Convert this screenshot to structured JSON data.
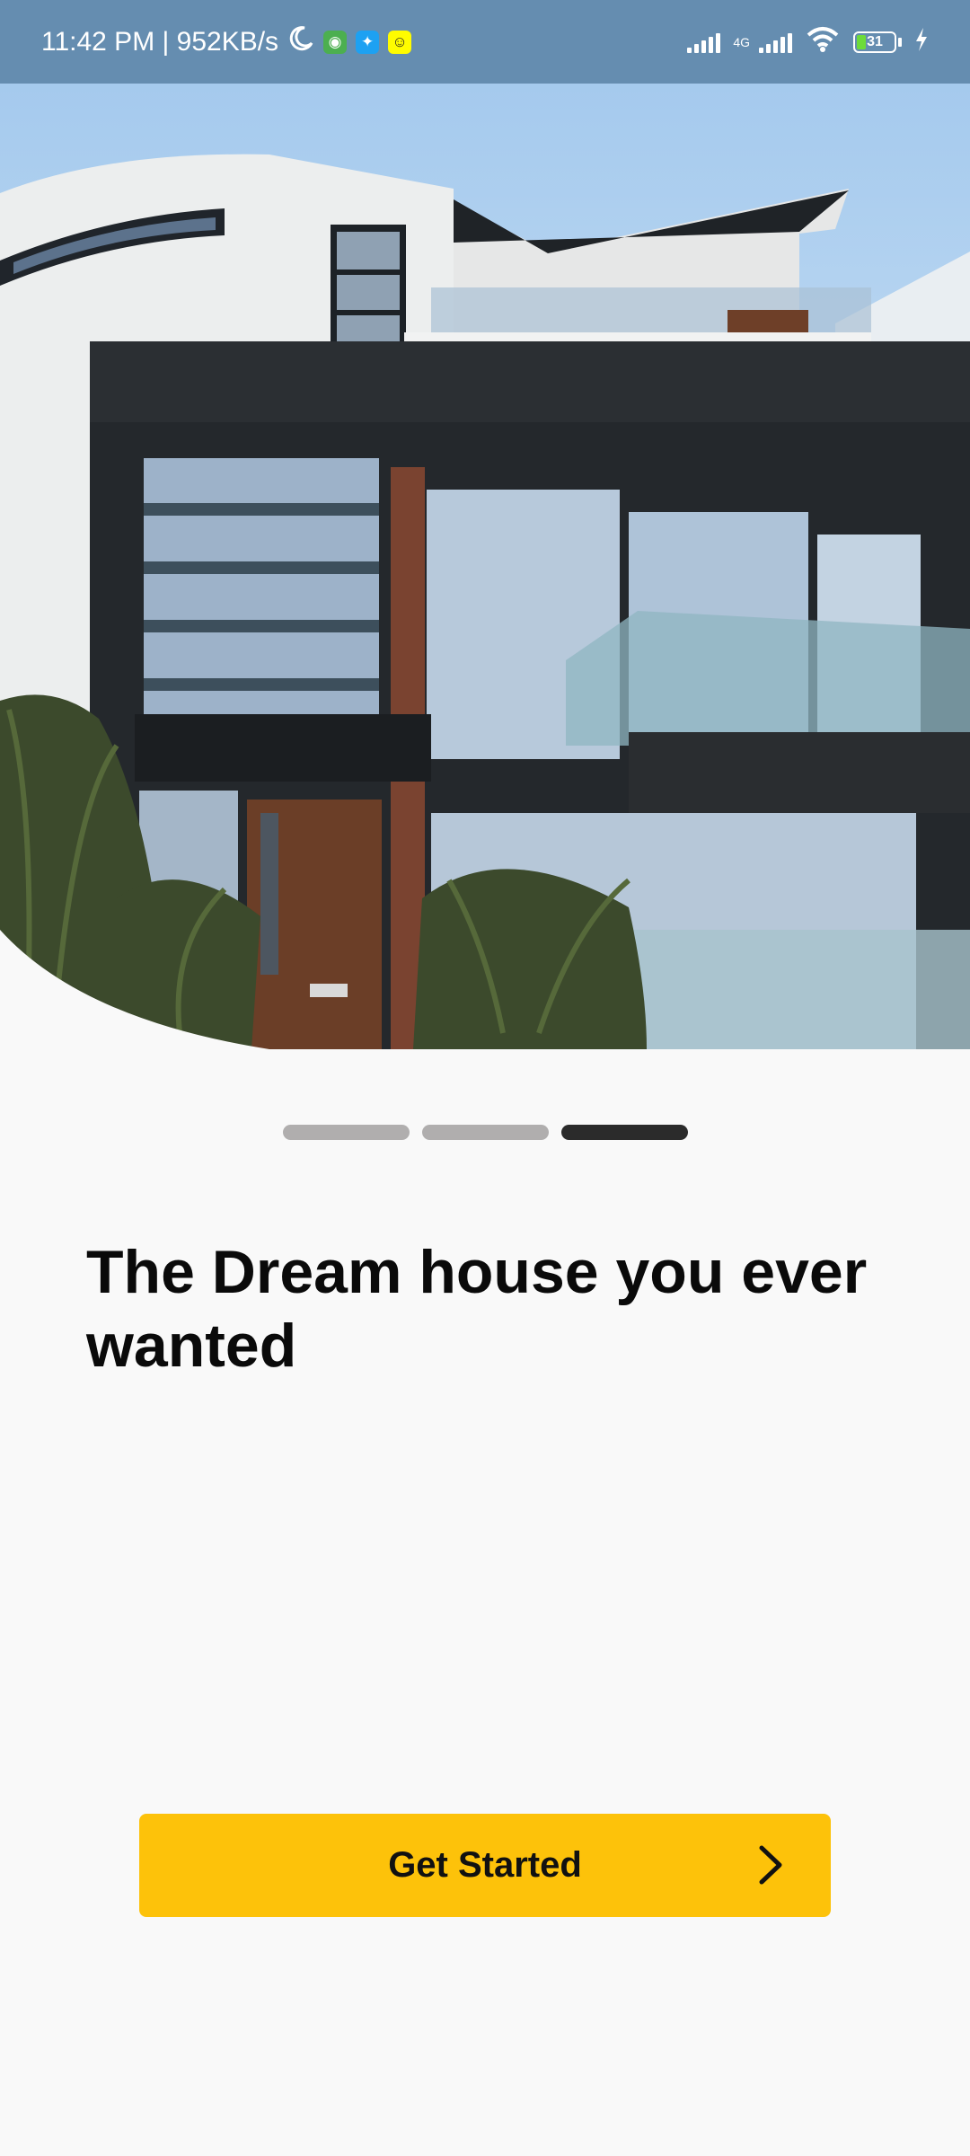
{
  "status_bar": {
    "time_speed": "11:42 PM | 952KB/s",
    "network_tag": "4G",
    "battery_level": "31"
  },
  "hero": {
    "image": "modern-house-photo"
  },
  "pager": {
    "pages": 3,
    "active_index": 2
  },
  "onboarding": {
    "headline": "The Dream house you ever wanted"
  },
  "cta": {
    "label": "Get Started",
    "icon": "chevron-right-icon"
  },
  "colors": {
    "accent": "#fdc20a",
    "background": "#f9f9f9",
    "text": "#0a0a0a"
  }
}
